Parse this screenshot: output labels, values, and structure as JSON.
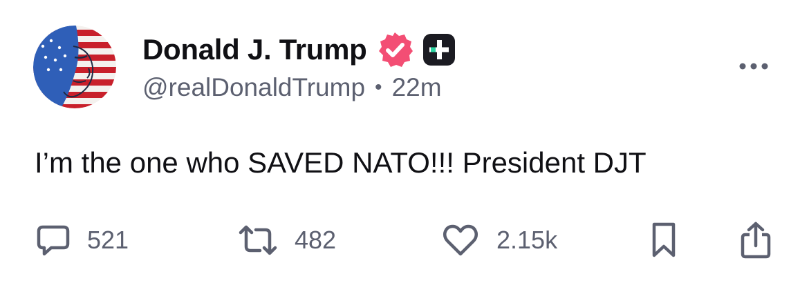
{
  "post": {
    "author": {
      "display_name": "Donald J. Trump",
      "handle": "@realDonaldTrump",
      "avatar_icon": "flag-portrait-avatar",
      "verified_icon": "verified-badge-icon",
      "subscriber_icon": "plus-badge-icon"
    },
    "time_separator": "•",
    "time_ago": "22m",
    "text": "I’m the one who SAVED NATO!!! President DJT",
    "actions": {
      "reply_count": "521",
      "repost_count": "482",
      "like_count": "2.15k"
    }
  },
  "colors": {
    "verified": "#f34e74",
    "badge_dark": "#1b1b22",
    "badge_accent": "#2bd4a2",
    "muted": "#5c6070",
    "icon": "#5c6070"
  }
}
